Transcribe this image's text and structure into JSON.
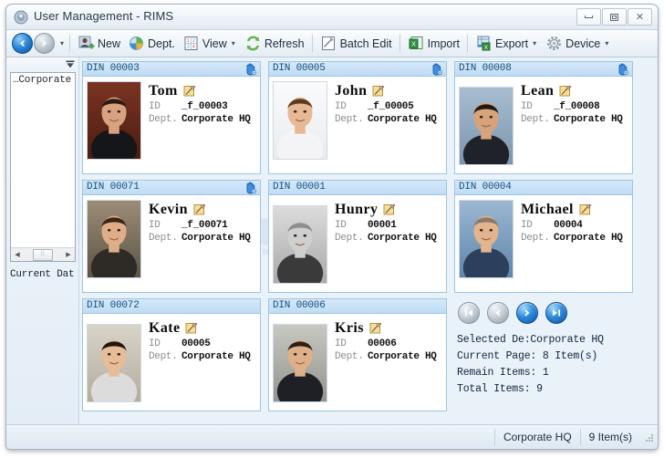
{
  "window": {
    "title": "User Management - RIMS",
    "icon": "app-icon",
    "buttons": {
      "minimize": "minimize-icon",
      "maximize": "maximize-icon",
      "close": "close-icon"
    }
  },
  "toolbar": {
    "back": "back-arrow-icon",
    "forward": "forward-arrow-icon",
    "history_caret": "▾",
    "items": [
      {
        "label": "New",
        "icon": "new-user-icon",
        "caret": false
      },
      {
        "label": "Dept.",
        "icon": "department-icon",
        "caret": false
      },
      {
        "label": "View",
        "icon": "view-grid-icon",
        "caret": true
      },
      {
        "label": "Refresh",
        "icon": "refresh-icon",
        "caret": false
      },
      {
        "label": "Batch Edit",
        "icon": "batch-edit-icon",
        "caret": false
      },
      {
        "label": "Import",
        "icon": "import-excel-icon",
        "caret": false
      },
      {
        "label": "Export",
        "icon": "export-excel-icon",
        "caret": true
      },
      {
        "label": "Device",
        "icon": "device-gear-icon",
        "caret": true
      }
    ]
  },
  "sidebar": {
    "dropdown_icon": "collapse-dropdown-icon",
    "tree": {
      "nodes": [
        {
          "label": "Corporate",
          "prefix": "…"
        }
      ]
    },
    "hscroll": {
      "left": "◀",
      "right": "▶",
      "thumb": "⦙⦙"
    },
    "caption": "Current Dat"
  },
  "cards": [
    {
      "din": "DIN 00003",
      "hand": true,
      "name": "Tom",
      "id_key": "ID",
      "id_val": "_f_00003",
      "dept_key": "Dept.",
      "dept_val": "Corporate HQ",
      "photo": "portrait-tom",
      "photo_bg": "#6b2f22",
      "align": "top"
    },
    {
      "din": "DIN 00005",
      "hand": true,
      "name": "John",
      "id_key": "ID",
      "id_val": "_f_00005",
      "dept_key": "Dept.",
      "dept_val": "Corporate HQ",
      "photo": "portrait-john",
      "photo_bg": "#f2f3f5",
      "align": "top"
    },
    {
      "din": "DIN 00008",
      "hand": true,
      "name": "Lean",
      "id_key": "ID",
      "id_val": "_f_00008",
      "dept_key": "Dept.",
      "dept_val": "Corporate HQ",
      "photo": "portrait-lean",
      "photo_bg": "#9fb4c6",
      "align": "mid"
    },
    {
      "din": "DIN 00071",
      "hand": true,
      "name": "Kevin",
      "id_key": "ID",
      "id_val": "_f_00071",
      "dept_key": "Dept.",
      "dept_val": "Corporate HQ",
      "photo": "portrait-kevin",
      "photo_bg": "#7d7265",
      "align": "top"
    },
    {
      "din": "DIN 00001",
      "hand": false,
      "name": "Hunry",
      "id_key": "ID",
      "id_val": "00001",
      "dept_key": "Dept.",
      "dept_val": "Corporate HQ",
      "photo": "portrait-hunry",
      "photo_bg": "#b9bcbe",
      "align": "mid"
    },
    {
      "din": "DIN 00004",
      "hand": false,
      "name": "Michael",
      "id_key": "ID",
      "id_val": "00004",
      "dept_key": "Dept.",
      "dept_val": "Corporate HQ",
      "photo": "portrait-michael",
      "photo_bg": "#7b93ad",
      "align": "top"
    },
    {
      "din": "DIN 00072",
      "hand": false,
      "name": "Kate",
      "id_key": "ID",
      "id_val": "00005",
      "dept_key": "Dept.",
      "dept_val": "Corporate HQ",
      "photo": "portrait-kate",
      "photo_bg": "#c9c6bc",
      "align": "mid"
    },
    {
      "din": "DIN 00006",
      "hand": false,
      "name": "Kris",
      "id_key": "ID",
      "id_val": "00006",
      "dept_key": "Dept.",
      "dept_val": "Corporate HQ",
      "photo": "portrait-kris",
      "photo_bg": "#b3b4ae",
      "align": "mid"
    }
  ],
  "info_panel": {
    "pager": [
      {
        "name": "first-page-button",
        "icon": "first-page-icon",
        "state": "disabled"
      },
      {
        "name": "previous-page-button",
        "icon": "previous-page-icon",
        "state": "disabled"
      },
      {
        "name": "next-page-button",
        "icon": "next-page-icon",
        "state": "enabled"
      },
      {
        "name": "last-page-button",
        "icon": "last-page-icon",
        "state": "enabled"
      }
    ],
    "stats": [
      "Selected De:Corporate HQ",
      "Current Page: 8 Item(s)",
      "Remain Items: 1",
      "Total Items: 9"
    ]
  },
  "statusbar": {
    "department": "Corporate HQ",
    "count": "9 Item(s)",
    "grip": "resize-grip-icon"
  },
  "watermark": {
    "text": "sure",
    "subtext": "Professional Service Provider"
  },
  "colors": {
    "accent": "#2c88d8",
    "card_header": "#bfdcf4",
    "card_border": "#9fc4e3",
    "din_text": "#13507f",
    "panel_bg": "#e9f1f9"
  }
}
